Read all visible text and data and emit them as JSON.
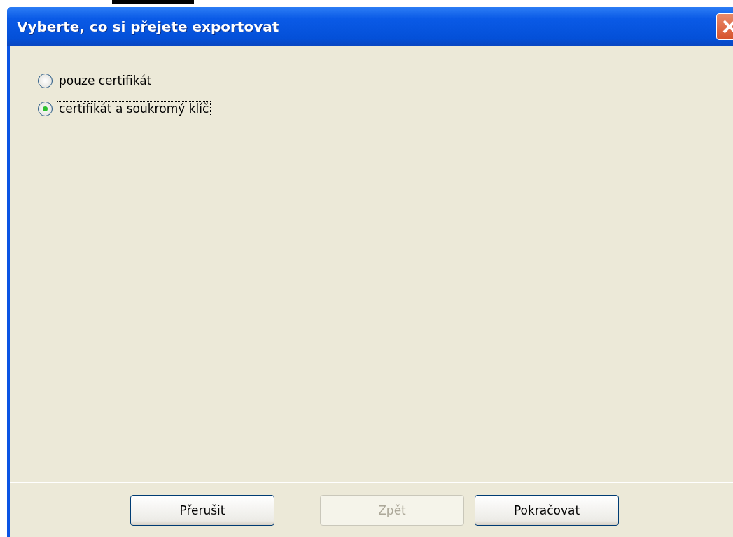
{
  "window": {
    "title": "Vyberte, co si přejete exportovat"
  },
  "options": [
    {
      "label": "pouze certifikát",
      "selected": false
    },
    {
      "label": "certifikát a soukromý klíč",
      "selected": true
    }
  ],
  "buttons": [
    {
      "label": "Přerušit",
      "disabled": false
    },
    {
      "label": "Zpět",
      "disabled": true
    },
    {
      "label": "Pokračovat",
      "disabled": false
    }
  ]
}
